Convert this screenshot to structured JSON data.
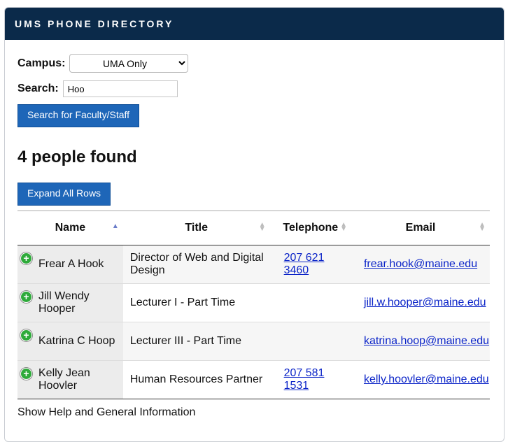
{
  "header": {
    "title": "UMS PHONE DIRECTORY"
  },
  "form": {
    "campus_label": "Campus:",
    "campus_selected": "UMA Only",
    "search_label": "Search:",
    "search_value": "Hoo",
    "search_button": "Search for Faculty/Staff"
  },
  "results": {
    "count_text": "4 people found",
    "expand_button": "Expand All Rows",
    "columns": [
      "Name",
      "Title",
      "Telephone",
      "Email"
    ],
    "rows": [
      {
        "name": "Frear A Hook",
        "title": "Director of Web and Digital Design",
        "phone_line1": "207 621",
        "phone_line2": "3460",
        "email": "frear.hook@maine.edu"
      },
      {
        "name": "Jill Wendy Hooper",
        "title": "Lecturer I - Part Time",
        "phone_line1": "",
        "phone_line2": "",
        "email": "jill.w.hooper@maine.edu"
      },
      {
        "name": "Katrina C Hoop",
        "title": "Lecturer III - Part Time",
        "phone_line1": "",
        "phone_line2": "",
        "email": "katrina.hoop@maine.edu"
      },
      {
        "name": "Kelly Jean Hoovler",
        "title": "Human Resources Partner",
        "phone_line1": "207 581",
        "phone_line2": "1531",
        "email": "kelly.hoovler@maine.edu"
      }
    ]
  },
  "footer": {
    "help_link": "Show Help and General Information"
  },
  "icons": {
    "expand_row": "plus-circle-icon",
    "sort_ascending": "sort-ascending-icon",
    "sort_neutral": "sort-neutral-icon"
  },
  "colors": {
    "header_bg": "#0b2a4a",
    "button_bg": "#1e66b8",
    "expand_icon": "#2eaa3a",
    "link": "#0b24c8"
  }
}
